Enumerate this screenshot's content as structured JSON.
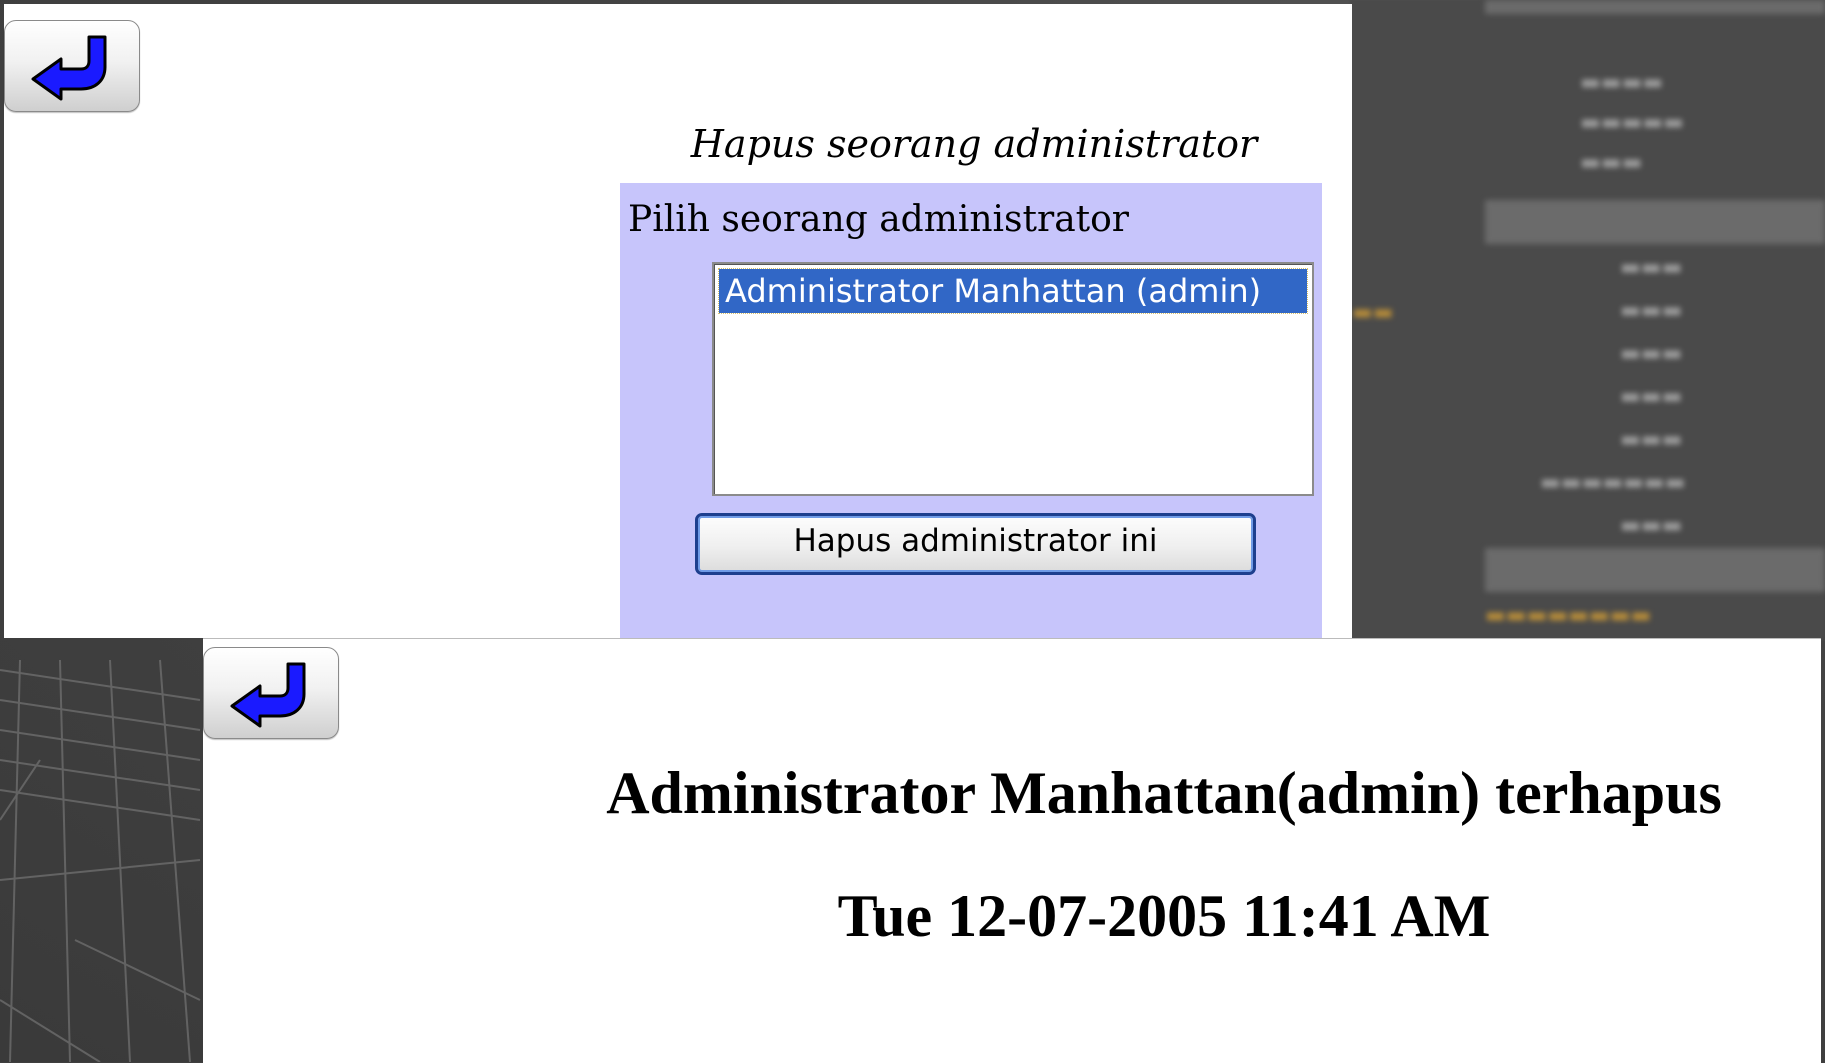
{
  "delete_form": {
    "title": "Hapus seorang administrator",
    "select_label": "Pilih seorang administrator",
    "admin_options": [
      "Administrator Manhattan (admin)"
    ],
    "selected_index": 0,
    "delete_button_label": "Hapus administrator ini",
    "panel_color": "#c7c5fb",
    "selection_color": "#3167c6"
  },
  "result": {
    "message": "Administrator Manhattan(admin) terhapus",
    "timestamp": "Tue 12-07-2005 11:41 AM"
  },
  "icons": {
    "back": "back-arrow-icon"
  }
}
